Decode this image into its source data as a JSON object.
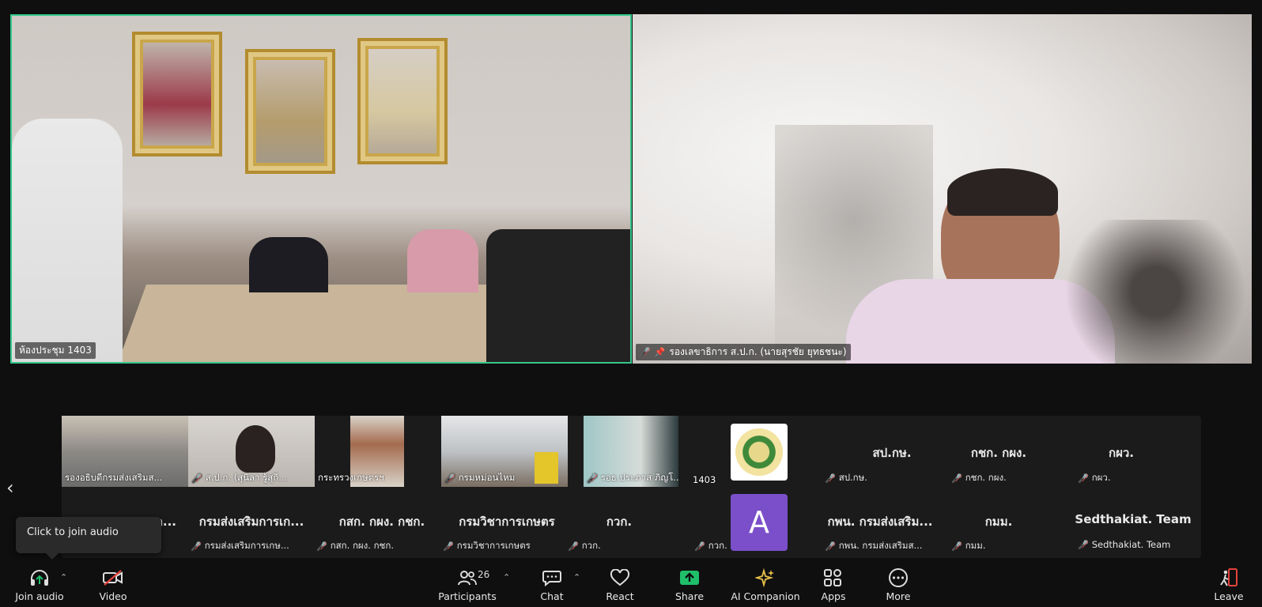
{
  "main_videos": [
    {
      "name": "ห้องประชุม 1403",
      "muted": false
    },
    {
      "name": "รองเลขาธิการ ส.ป.ก. (นายสุรชัย ยุทธชนะ)",
      "muted": true,
      "pinned": true
    }
  ],
  "strip": {
    "thumbs": [
      {
        "label": "รองอธิบดีกรมส่งเสริมส..."
      },
      {
        "label": "ส.ป.ก. (สุนิลา รู้สุกิ..."
      },
      {
        "label": "กระทรวงเกษตรฯ"
      },
      {
        "label": "กรมหม่อนไหม"
      },
      {
        "label": "รอธ.ประภาส ภิญโ..."
      },
      {
        "label": "1403"
      }
    ],
    "name_tiles_row1": [
      {
        "big": "สป.กษ.",
        "small": "สป.กษ."
      },
      {
        "big": "กชก. กผง.",
        "small": "กชก. กผง."
      },
      {
        "big": "กผว.",
        "small": "กผว."
      }
    ],
    "name_tiles_row2": [
      {
        "big": "...ก...",
        "small": ""
      },
      {
        "big": "กรมส่งเสริมการเก...",
        "small": "กรมส่งเสริมการเกษ..."
      },
      {
        "big": "กสก. กผง. กชก.",
        "small": "กสก. กผง. กชก."
      },
      {
        "big": "กรมวิชาการเกษตร",
        "small": "กรมวิชาการเกษตร"
      },
      {
        "big": "กวก.",
        "small": "กวก."
      },
      {
        "big": "",
        "small": "กวก."
      },
      {
        "big": "กพน. กรมส่งเสริม...",
        "small": "กพน. กรมส่งเสริมส..."
      },
      {
        "big": "กมม.",
        "small": "กมม."
      },
      {
        "big": "Sedthakiat. Team",
        "small": "Sedthakiat. Team"
      }
    ],
    "avatar_letter": "A",
    "avatar_color": "#7b4fc9"
  },
  "tooltip": "Click to join audio",
  "toolbar": {
    "join_audio": "Join audio",
    "video": "Video",
    "participants": "Participants",
    "participants_count": "26",
    "chat": "Chat",
    "react": "React",
    "share": "Share",
    "ai_companion": "AI Companion",
    "apps": "Apps",
    "more": "More",
    "leave": "Leave"
  },
  "colors": {
    "active_speaker_border": "#35c78b",
    "share_green": "#1fbf6a",
    "leave_red": "#e4443c",
    "mute_red": "#e4443c"
  }
}
